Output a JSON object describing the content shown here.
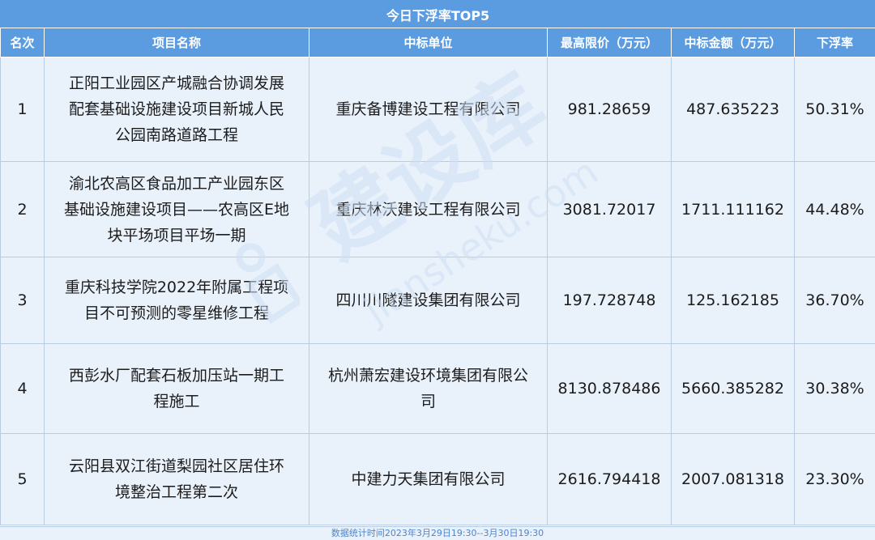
{
  "title": "今日下浮率TOP5",
  "columns": [
    "名次",
    "项目名称",
    "中标单位",
    "最高限价（万元）",
    "中标金额（万元）",
    "下浮率"
  ],
  "rows": [
    {
      "rank": "1",
      "project_lines": [
        "正阳工业园区产城融合协调发展",
        "配套基础设施建设项目新城人民",
        "公园南路道路工程"
      ],
      "company_lines": [
        "重庆备博建设工程有限公司"
      ],
      "max_price": "981.28659",
      "bid_amount": "487.635223",
      "rate": "50.31%"
    },
    {
      "rank": "2",
      "project_lines": [
        "渝北农高区食品加工产业园东区",
        "基础设施建设项目——农高区E地",
        "块平场项目平场一期"
      ],
      "company_lines": [
        "重庆林沃建设工程有限公司"
      ],
      "max_price": "3081.72017",
      "bid_amount": "1711.111162",
      "rate": "44.48%"
    },
    {
      "rank": "3",
      "project_lines": [
        "重庆科技学院2022年附属工程项",
        "目不可预测的零星维修工程"
      ],
      "company_lines": [
        "四川川隧建设集团有限公司"
      ],
      "max_price": "197.728748",
      "bid_amount": "125.162185",
      "rate": "36.70%"
    },
    {
      "rank": "4",
      "project_lines": [
        "西彭水厂配套石板加压站一期工",
        "程施工"
      ],
      "company_lines": [
        "杭州萧宏建设环境集团有限公",
        "司"
      ],
      "max_price": "8130.878486",
      "bid_amount": "5660.385282",
      "rate": "30.38%"
    },
    {
      "rank": "5",
      "project_lines": [
        "云阳县双江街道梨园社区居住环",
        "境整治工程第二次"
      ],
      "company_lines": [
        "中建力天集团有限公司"
      ],
      "max_price": "2616.794418",
      "bid_amount": "2007.081318",
      "rate": "23.30%"
    }
  ],
  "footer": "数据统计时间2023年3月29日19:30--3月30日19:30",
  "watermark": {
    "main": "建设库",
    "sub": "jianshek​u.com"
  },
  "colors": {
    "header_bg": "#5b9be0",
    "row_bg": "#e9f1fb",
    "border": "#b9cbe3",
    "footer_text": "#4a86d0"
  }
}
